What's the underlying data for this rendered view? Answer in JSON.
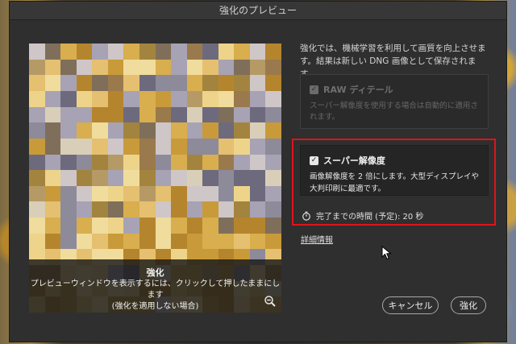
{
  "dialog": {
    "title": "強化のプレビュー"
  },
  "preview": {
    "overlay_title": "強化",
    "overlay_line1": "プレビューウィンドウを表示するには、クリックして押したままにします",
    "overlay_line2": "(強化を適用しない場合)",
    "zoom_icon": "zoom-out-icon"
  },
  "panel": {
    "description": "強化では、機械学習を利用して画質を向上させます。結果は新しい DNG 画像として保存されます。",
    "raw_details": {
      "label": "RAW ディテール",
      "checked": true,
      "enabled": false,
      "description": "スーパー解像度を使用する場合は自動的に適用されます。"
    },
    "super_resolution": {
      "label": "スーパー解像度",
      "checked": true,
      "enabled": true,
      "description": "画像解像度を 2 倍にします。大型ディスプレイや大判印刷に最適です。"
    },
    "estimated_time": "完了までの時間 (予定): 20 秒",
    "details_link": "詳細情報"
  },
  "buttons": {
    "cancel": "キャンセル",
    "enhance": "強化"
  },
  "colors": {
    "dialog_bg": "#2f2f2f",
    "highlight_border": "#e0131b",
    "text": "#e6e6e6"
  }
}
